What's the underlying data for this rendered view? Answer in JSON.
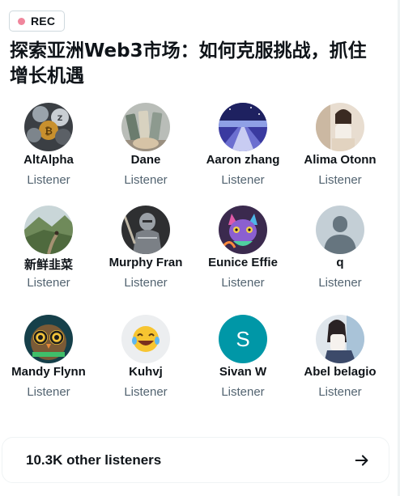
{
  "badge": {
    "label": "REC",
    "dot_color": "#f0869c"
  },
  "space": {
    "title": "探索亚洲Web3市场：如何克服挑战，抓住增长机遇"
  },
  "participants": [
    {
      "name": "AltAlpha",
      "role": "Listener",
      "avatar": "crypto-coins-avatar"
    },
    {
      "name": "Dane",
      "role": "Listener",
      "avatar": "money-cards-avatar"
    },
    {
      "name": "Aaron zhang",
      "role": "Listener",
      "avatar": "road-horizon-avatar"
    },
    {
      "name": "Alima Otonn",
      "role": "Listener",
      "avatar": "woman-photo-avatar"
    },
    {
      "name": "新鲜韭菜",
      "role": "Listener",
      "avatar": "mountain-landscape-avatar"
    },
    {
      "name": "Murphy Fran",
      "role": "Listener",
      "avatar": "knight-armor-avatar"
    },
    {
      "name": "Eunice Effie",
      "role": "Listener",
      "avatar": "colorful-cat-avatar"
    },
    {
      "name": "q",
      "role": "Listener",
      "avatar": "default-profile-avatar"
    },
    {
      "name": "Mandy Flynn",
      "role": "Listener",
      "avatar": "owl-glasses-avatar"
    },
    {
      "name": "Kuhvj",
      "role": "Listener",
      "avatar": "laughing-emoji-avatar"
    },
    {
      "name": "Sivan W",
      "role": "Listener",
      "avatar": "letter-avatar",
      "initial": "S",
      "color": "#0097a7"
    },
    {
      "name": "Abel belagio",
      "role": "Listener",
      "avatar": "woman-photo-avatar"
    }
  ],
  "other_listeners": {
    "label": "10.3K other listeners",
    "icon": "arrow-right-icon"
  }
}
